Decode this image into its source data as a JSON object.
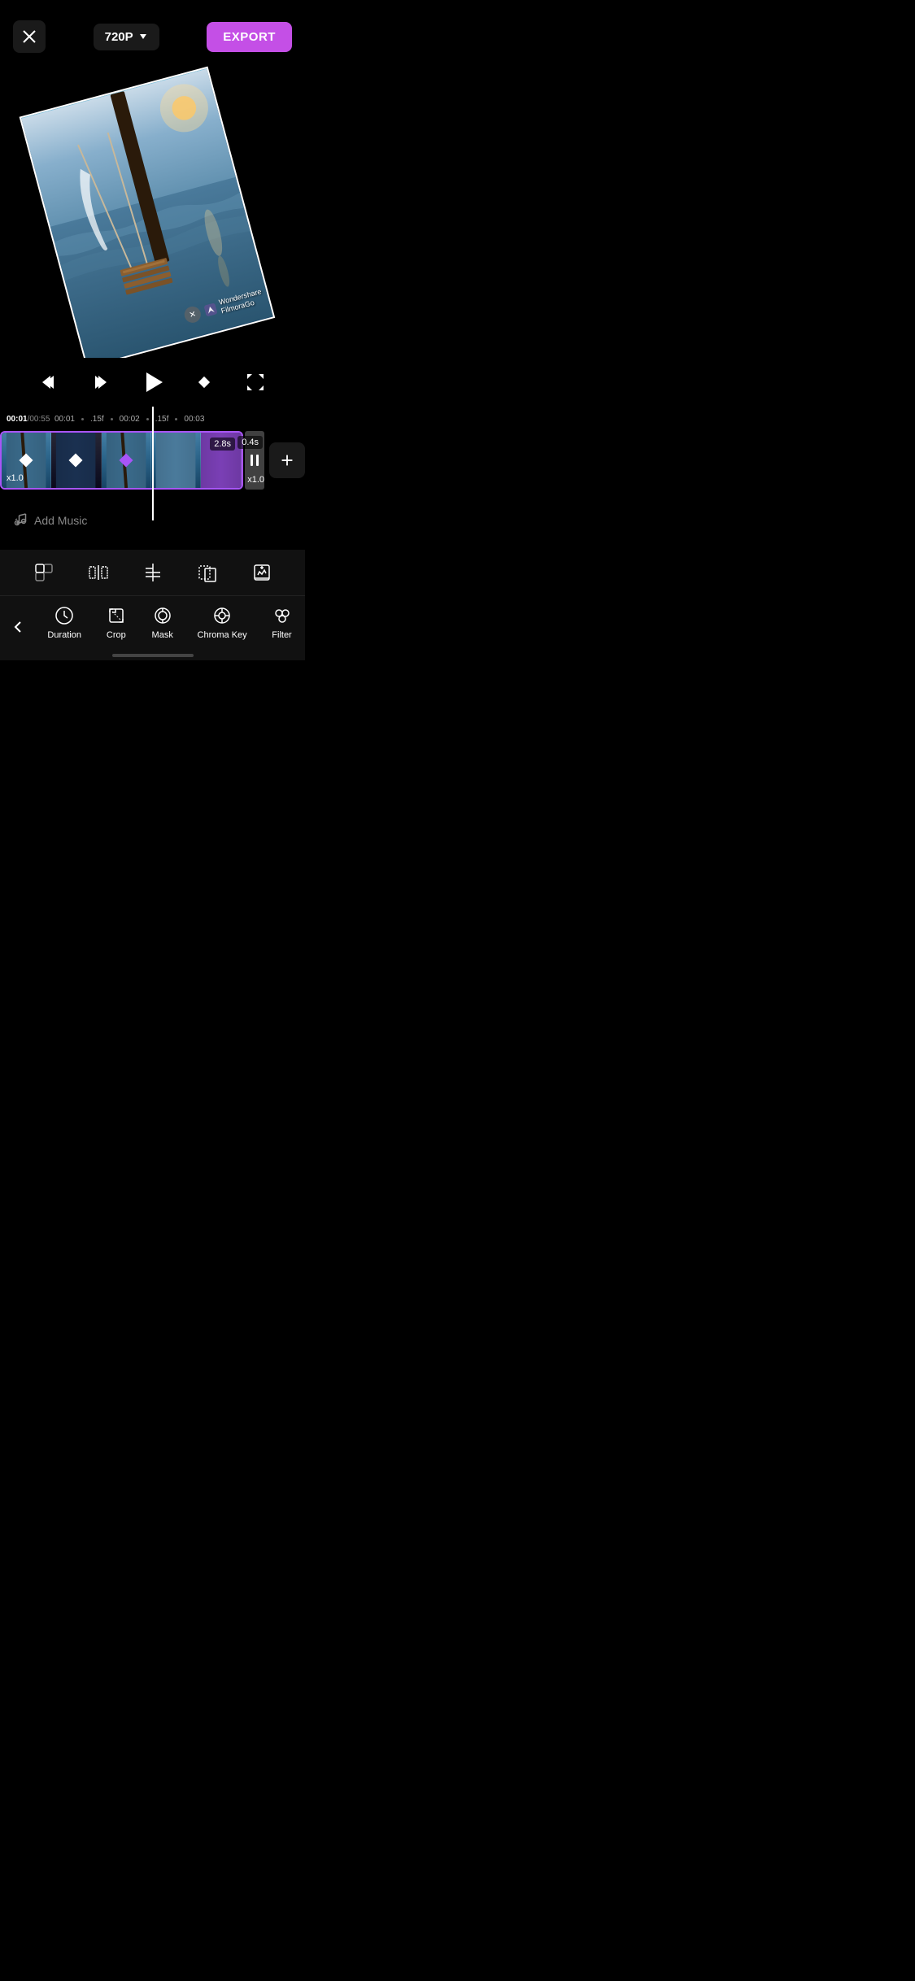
{
  "topbar": {
    "close_label": "×",
    "resolution": "720P",
    "export_label": "EXPORT"
  },
  "timeline": {
    "current_time": "00:01",
    "total_time": "00:55",
    "markers": [
      "00:01",
      ".15f",
      "00:02",
      ".15f",
      "00:03"
    ],
    "clip_duration": "2.8s",
    "clip_speed": "x1.0",
    "clip_duration2": "0.4s",
    "clip_speed2": "x1.0"
  },
  "music": {
    "add_label": "Add Music"
  },
  "bottom_nav": {
    "tabs": [
      {
        "id": "duration",
        "label": "Duration"
      },
      {
        "id": "crop",
        "label": "Crop"
      },
      {
        "id": "mask",
        "label": "Mask"
      },
      {
        "id": "chroma",
        "label": "Chroma Key"
      },
      {
        "id": "filter",
        "label": "Filter"
      }
    ]
  },
  "watermark": {
    "brand": "Wondershare",
    "product": "FilmoraGo"
  }
}
